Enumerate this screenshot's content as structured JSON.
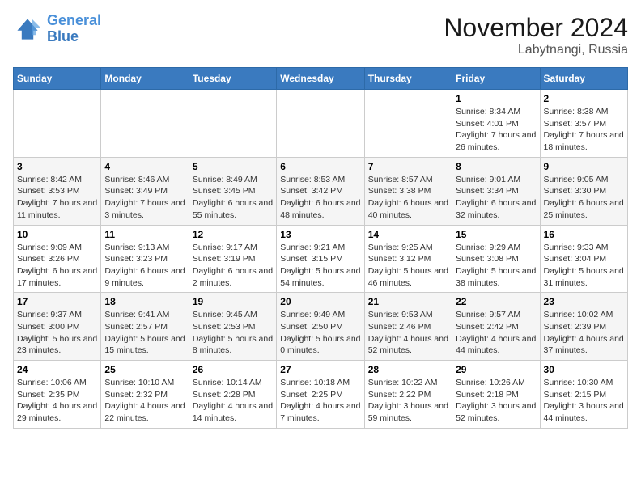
{
  "logo": {
    "text_general": "General",
    "text_blue": "Blue"
  },
  "title": "November 2024",
  "subtitle": "Labytnangi, Russia",
  "weekdays": [
    "Sunday",
    "Monday",
    "Tuesday",
    "Wednesday",
    "Thursday",
    "Friday",
    "Saturday"
  ],
  "weeks": [
    [
      {
        "day": "",
        "info": ""
      },
      {
        "day": "",
        "info": ""
      },
      {
        "day": "",
        "info": ""
      },
      {
        "day": "",
        "info": ""
      },
      {
        "day": "",
        "info": ""
      },
      {
        "day": "1",
        "info": "Sunrise: 8:34 AM\nSunset: 4:01 PM\nDaylight: 7 hours and 26 minutes."
      },
      {
        "day": "2",
        "info": "Sunrise: 8:38 AM\nSunset: 3:57 PM\nDaylight: 7 hours and 18 minutes."
      }
    ],
    [
      {
        "day": "3",
        "info": "Sunrise: 8:42 AM\nSunset: 3:53 PM\nDaylight: 7 hours and 11 minutes."
      },
      {
        "day": "4",
        "info": "Sunrise: 8:46 AM\nSunset: 3:49 PM\nDaylight: 7 hours and 3 minutes."
      },
      {
        "day": "5",
        "info": "Sunrise: 8:49 AM\nSunset: 3:45 PM\nDaylight: 6 hours and 55 minutes."
      },
      {
        "day": "6",
        "info": "Sunrise: 8:53 AM\nSunset: 3:42 PM\nDaylight: 6 hours and 48 minutes."
      },
      {
        "day": "7",
        "info": "Sunrise: 8:57 AM\nSunset: 3:38 PM\nDaylight: 6 hours and 40 minutes."
      },
      {
        "day": "8",
        "info": "Sunrise: 9:01 AM\nSunset: 3:34 PM\nDaylight: 6 hours and 32 minutes."
      },
      {
        "day": "9",
        "info": "Sunrise: 9:05 AM\nSunset: 3:30 PM\nDaylight: 6 hours and 25 minutes."
      }
    ],
    [
      {
        "day": "10",
        "info": "Sunrise: 9:09 AM\nSunset: 3:26 PM\nDaylight: 6 hours and 17 minutes."
      },
      {
        "day": "11",
        "info": "Sunrise: 9:13 AM\nSunset: 3:23 PM\nDaylight: 6 hours and 9 minutes."
      },
      {
        "day": "12",
        "info": "Sunrise: 9:17 AM\nSunset: 3:19 PM\nDaylight: 6 hours and 2 minutes."
      },
      {
        "day": "13",
        "info": "Sunrise: 9:21 AM\nSunset: 3:15 PM\nDaylight: 5 hours and 54 minutes."
      },
      {
        "day": "14",
        "info": "Sunrise: 9:25 AM\nSunset: 3:12 PM\nDaylight: 5 hours and 46 minutes."
      },
      {
        "day": "15",
        "info": "Sunrise: 9:29 AM\nSunset: 3:08 PM\nDaylight: 5 hours and 38 minutes."
      },
      {
        "day": "16",
        "info": "Sunrise: 9:33 AM\nSunset: 3:04 PM\nDaylight: 5 hours and 31 minutes."
      }
    ],
    [
      {
        "day": "17",
        "info": "Sunrise: 9:37 AM\nSunset: 3:00 PM\nDaylight: 5 hours and 23 minutes."
      },
      {
        "day": "18",
        "info": "Sunrise: 9:41 AM\nSunset: 2:57 PM\nDaylight: 5 hours and 15 minutes."
      },
      {
        "day": "19",
        "info": "Sunrise: 9:45 AM\nSunset: 2:53 PM\nDaylight: 5 hours and 8 minutes."
      },
      {
        "day": "20",
        "info": "Sunrise: 9:49 AM\nSunset: 2:50 PM\nDaylight: 5 hours and 0 minutes."
      },
      {
        "day": "21",
        "info": "Sunrise: 9:53 AM\nSunset: 2:46 PM\nDaylight: 4 hours and 52 minutes."
      },
      {
        "day": "22",
        "info": "Sunrise: 9:57 AM\nSunset: 2:42 PM\nDaylight: 4 hours and 44 minutes."
      },
      {
        "day": "23",
        "info": "Sunrise: 10:02 AM\nSunset: 2:39 PM\nDaylight: 4 hours and 37 minutes."
      }
    ],
    [
      {
        "day": "24",
        "info": "Sunrise: 10:06 AM\nSunset: 2:35 PM\nDaylight: 4 hours and 29 minutes."
      },
      {
        "day": "25",
        "info": "Sunrise: 10:10 AM\nSunset: 2:32 PM\nDaylight: 4 hours and 22 minutes."
      },
      {
        "day": "26",
        "info": "Sunrise: 10:14 AM\nSunset: 2:28 PM\nDaylight: 4 hours and 14 minutes."
      },
      {
        "day": "27",
        "info": "Sunrise: 10:18 AM\nSunset: 2:25 PM\nDaylight: 4 hours and 7 minutes."
      },
      {
        "day": "28",
        "info": "Sunrise: 10:22 AM\nSunset: 2:22 PM\nDaylight: 3 hours and 59 minutes."
      },
      {
        "day": "29",
        "info": "Sunrise: 10:26 AM\nSunset: 2:18 PM\nDaylight: 3 hours and 52 minutes."
      },
      {
        "day": "30",
        "info": "Sunrise: 10:30 AM\nSunset: 2:15 PM\nDaylight: 3 hours and 44 minutes."
      }
    ]
  ]
}
